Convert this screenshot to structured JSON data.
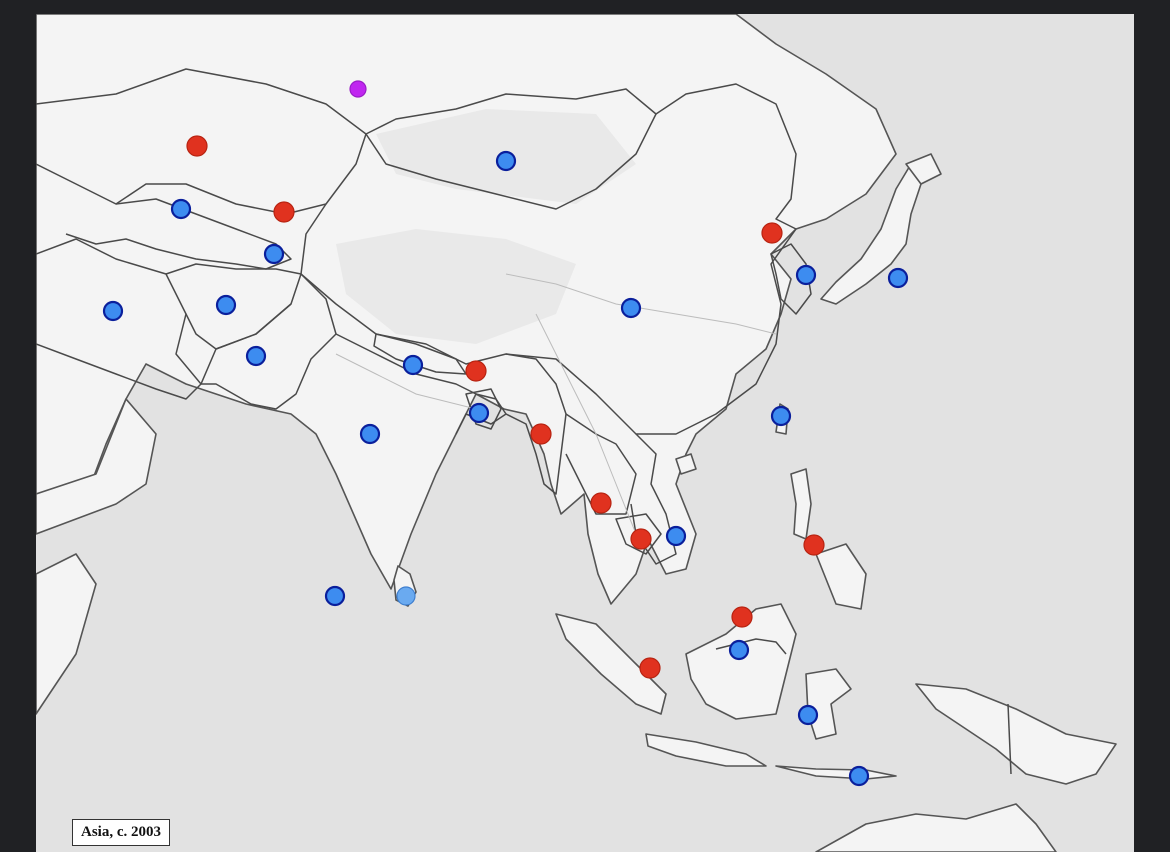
{
  "map": {
    "caption": "Asia, c. 2003",
    "colors": {
      "background": "#202124",
      "sea": "#e2e2e2",
      "land": "#f4f4f4",
      "border": "#4a4a4a"
    },
    "marker_styles": {
      "red": {
        "fill": "#e0321f",
        "stroke": "#b82412"
      },
      "blue": {
        "fill": "#3d8cf0",
        "stroke": "#0a1f9c"
      },
      "purple": {
        "fill": "#c026f0",
        "stroke": "#9a1cc7"
      },
      "light-blue": {
        "fill": "#6aaaf0",
        "stroke": "#3f7fcf"
      }
    },
    "markers": [
      {
        "id": "purple-1",
        "color": "purple"
      },
      {
        "id": "red-1",
        "color": "red"
      },
      {
        "id": "blue-1",
        "color": "blue"
      },
      {
        "id": "red-2",
        "color": "red"
      },
      {
        "id": "blue-2",
        "color": "blue"
      },
      {
        "id": "blue-3",
        "color": "blue"
      },
      {
        "id": "red-3",
        "color": "red"
      },
      {
        "id": "blue-4",
        "color": "blue"
      },
      {
        "id": "blue-5",
        "color": "blue"
      },
      {
        "id": "blue-6",
        "color": "blue"
      },
      {
        "id": "blue-7",
        "color": "blue"
      },
      {
        "id": "blue-8",
        "color": "blue"
      },
      {
        "id": "blue-9",
        "color": "blue"
      },
      {
        "id": "red-4",
        "color": "red"
      },
      {
        "id": "blue-10",
        "color": "blue"
      },
      {
        "id": "blue-11",
        "color": "blue"
      },
      {
        "id": "red-5",
        "color": "red"
      },
      {
        "id": "blue-12",
        "color": "blue"
      },
      {
        "id": "blue-13",
        "color": "blue"
      },
      {
        "id": "red-6",
        "color": "red"
      },
      {
        "id": "red-7",
        "color": "red"
      },
      {
        "id": "blue-14",
        "color": "blue"
      },
      {
        "id": "red-8",
        "color": "red"
      },
      {
        "id": "blue-15",
        "color": "blue"
      },
      {
        "id": "light-blue-1",
        "color": "light-blue"
      },
      {
        "id": "red-9",
        "color": "red"
      },
      {
        "id": "blue-16",
        "color": "blue"
      },
      {
        "id": "red-10",
        "color": "red"
      },
      {
        "id": "blue-17",
        "color": "blue"
      },
      {
        "id": "blue-18",
        "color": "blue"
      }
    ]
  }
}
